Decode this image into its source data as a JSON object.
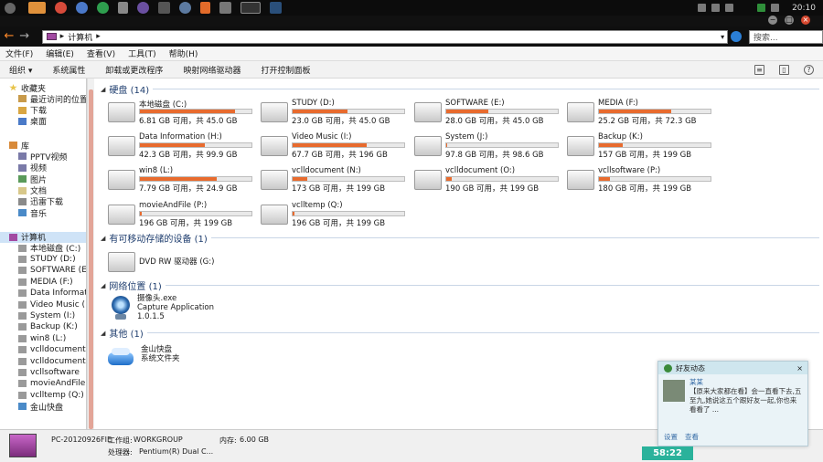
{
  "taskbar": {
    "clock": "20:10"
  },
  "address": {
    "crumb": "计算机",
    "search_placeholder": "搜索..."
  },
  "menu": [
    "文件(F)",
    "编辑(E)",
    "查看(V)",
    "工具(T)",
    "帮助(H)"
  ],
  "toolbar": [
    "组织",
    "系统属性",
    "卸载或更改程序",
    "映射网络驱动器",
    "打开控制面板"
  ],
  "sidebar": {
    "favorites_title": "收藏夹",
    "favorites": [
      "最近访问的位置",
      "下载",
      "桌面"
    ],
    "library_title": "库",
    "libraries": [
      "PPTV视频",
      "视频",
      "图片",
      "文档",
      "迅雷下载",
      "音乐"
    ],
    "computer_title": "计算机",
    "drives": [
      "本地磁盘 (C:)",
      "STUDY (D:)",
      "SOFTWARE (E:)",
      "MEDIA (F:)",
      "Data Informat",
      "Video Music (",
      "System (I:)",
      "Backup (K:)",
      "win8 (L:)",
      "vclldocument (",
      "vclldocument",
      "vcllsoftware",
      "movieAndFile",
      "vclltemp (Q:)",
      "金山快盘"
    ]
  },
  "groups": {
    "hdd": "硬盘 (14)",
    "removable": "有可移动存储的设备 (1)",
    "network": "网络位置 (1)",
    "other": "其他 (1)"
  },
  "drives": [
    {
      "name": "本地磁盘 (C:)",
      "free": "6.81 GB 可用，共 45.0 GB",
      "used": 0.85
    },
    {
      "name": "STUDY (D:)",
      "free": "23.0 GB 可用，共 45.0 GB",
      "used": 0.49
    },
    {
      "name": "SOFTWARE (E:)",
      "free": "28.0 GB 可用，共 45.0 GB",
      "used": 0.38
    },
    {
      "name": "MEDIA (F:)",
      "free": "25.2 GB 可用，共 72.3 GB",
      "used": 0.65
    },
    {
      "name": "Data Information (H:)",
      "free": "42.3 GB 可用，共 99.9 GB",
      "used": 0.58
    },
    {
      "name": "Video Music (I:)",
      "free": "67.7 GB 可用，共 196 GB",
      "used": 0.66
    },
    {
      "name": "System (J:)",
      "free": "97.8 GB 可用，共 98.6 GB",
      "used": 0.01
    },
    {
      "name": "Backup (K:)",
      "free": "157 GB 可用，共 199 GB",
      "used": 0.21
    },
    {
      "name": "win8 (L:)",
      "free": "7.79 GB 可用，共 24.9 GB",
      "used": 0.69
    },
    {
      "name": "vclldocument (N:)",
      "free": "173 GB 可用，共 199 GB",
      "used": 0.13
    },
    {
      "name": "vclldocument (O:)",
      "free": "190 GB 可用，共 199 GB",
      "used": 0.05
    },
    {
      "name": "vcllsoftware (P:)",
      "free": "180 GB 可用，共 199 GB",
      "used": 0.1
    },
    {
      "name": "movieAndFile (P:)",
      "free": "196 GB 可用，共 199 GB",
      "used": 0.02
    },
    {
      "name": "vclltemp (Q:)",
      "free": "196 GB 可用，共 199 GB",
      "used": 0.02
    }
  ],
  "removable": {
    "name": "DVD RW 驱动器 (G:)"
  },
  "network_item": {
    "name": "摄像头.exe",
    "desc": "Capture Application",
    "ver": "1.0.1.5"
  },
  "other_item": {
    "name": "金山快盘",
    "desc": "系统文件夹"
  },
  "status": {
    "computer": "PC-20120926FIE",
    "workgroup_label": "工作组:",
    "workgroup": "WORKGROUP",
    "memory_label": "内存:",
    "memory": "6.00 GB",
    "cpu_label": "处理器:",
    "cpu": "Pentium(R) Dual C..."
  },
  "popup": {
    "title": "好友动态",
    "user": "某某",
    "text": "【原来大家都在看】会一直看下去,五至九,她说这五个跟好友一起,你也来看看了 ...",
    "links": [
      "设置",
      "查看"
    ]
  },
  "timebadge": "58:22",
  "colors": {
    "accent_fill": "#e86b2e",
    "timebadge": "#2ab29b"
  }
}
